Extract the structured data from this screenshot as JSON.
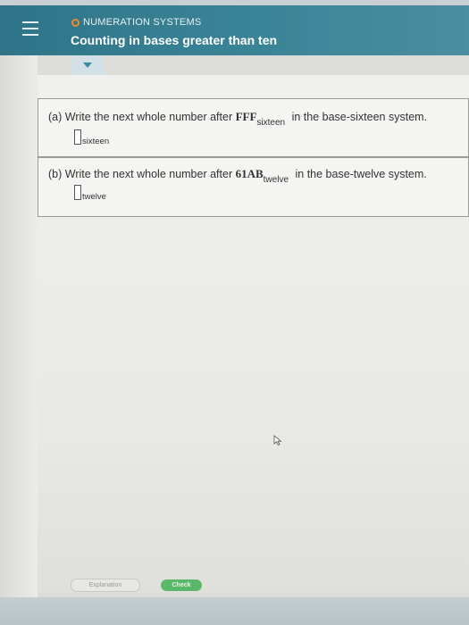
{
  "header": {
    "breadcrumb": "NUMERATION SYSTEMS",
    "title": "Counting in bases greater than ten",
    "icons": {
      "menu": "hamburger-icon",
      "section": "circle-icon",
      "expand": "triangle-down-icon"
    },
    "accent_color": "#2f7488"
  },
  "questions": [
    {
      "prefix": "(a) Write the next whole number after ",
      "number": "FFF",
      "base_subscript": "sixteen",
      "suffix": " in the base-sixteen system.",
      "answer_value": "",
      "answer_subscript": "sixteen"
    },
    {
      "prefix": "(b) Write the next whole number after ",
      "number": "61AB",
      "base_subscript": "twelve",
      "suffix": " in the base-twelve system.",
      "answer_value": "",
      "answer_subscript": "twelve"
    }
  ],
  "footer": {
    "explanation_label": "Explanation",
    "check_label": "Check",
    "check_color": "#5bb86a"
  }
}
